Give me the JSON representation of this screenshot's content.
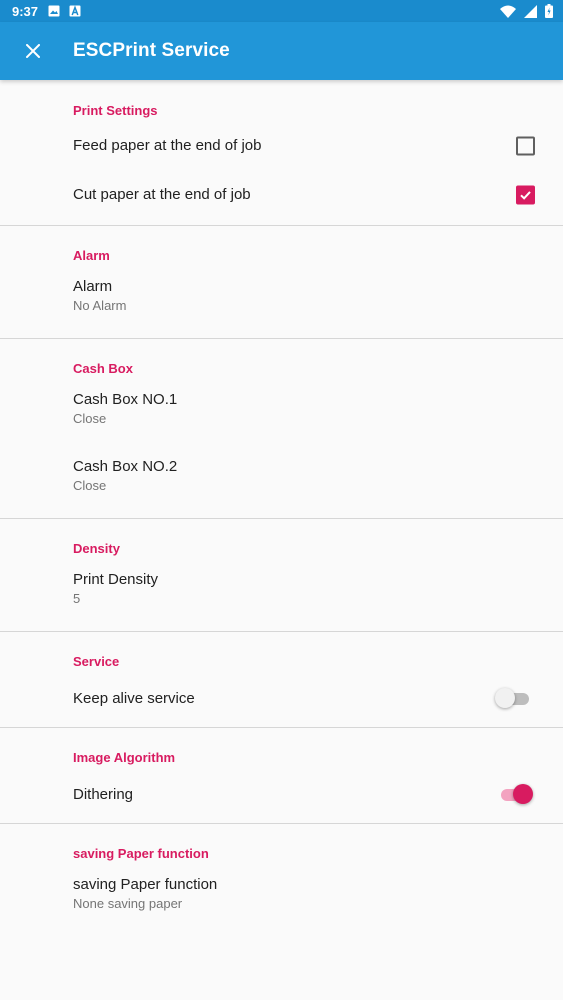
{
  "status_bar": {
    "time": "9:37",
    "icons": [
      "image-icon",
      "a-icon",
      "wifi-icon",
      "signal-icon",
      "battery-icon"
    ]
  },
  "app_bar": {
    "close_icon": "close-icon",
    "title": "ESCPrint Service"
  },
  "colors": {
    "status_bar": "#1a8bcd",
    "app_bar": "#2196d8",
    "accent": "#d81b60"
  },
  "sections": {
    "print_settings": {
      "title": "Print Settings",
      "feed_paper": {
        "label": "Feed paper at the end of job",
        "checked": false
      },
      "cut_paper": {
        "label": "Cut paper at the end of job",
        "checked": true
      }
    },
    "alarm": {
      "title": "Alarm",
      "alarm": {
        "label": "Alarm",
        "summary": "No Alarm"
      }
    },
    "cash_box": {
      "title": "Cash Box",
      "box1": {
        "label": "Cash Box NO.1",
        "summary": "Close"
      },
      "box2": {
        "label": "Cash Box NO.2",
        "summary": "Close"
      }
    },
    "density": {
      "title": "Density",
      "print_density": {
        "label": "Print Density",
        "summary": "5"
      }
    },
    "service": {
      "title": "Service",
      "keep_alive": {
        "label": "Keep alive service",
        "on": false
      }
    },
    "image_algorithm": {
      "title": "Image Algorithm",
      "dithering": {
        "label": "Dithering",
        "on": true
      }
    },
    "saving_paper": {
      "title": "saving Paper function",
      "saving": {
        "label": "saving Paper function",
        "summary": "None saving paper"
      }
    }
  }
}
